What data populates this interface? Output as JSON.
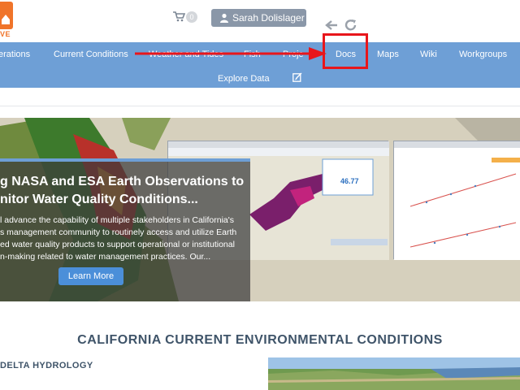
{
  "header": {
    "logo_text": "VE",
    "cart_count": "0",
    "user_name": "Sarah Dolislager",
    "icons": [
      "cart-icon",
      "user-icon",
      "undo-icon",
      "redo-icon"
    ]
  },
  "nav": {
    "row1": [
      "erations",
      "Current Conditions",
      "Weather and Tides",
      "Fish",
      "Proje",
      "Docs",
      "Maps",
      "Wiki",
      "Workgroups"
    ],
    "row2": [
      "Explore Data"
    ],
    "edit_icon": "edit-icon",
    "background": "#6e9fd6"
  },
  "annotation": {
    "target": "Docs",
    "box_color": "#e8161b",
    "arrow_color": "#e8161b"
  },
  "hero": {
    "title": "g NASA and ESA Earth Observations to\nnitor Water Quality Conditions...",
    "title_line1": "g NASA and ESA Earth Observations to",
    "title_line2": "nitor Water Quality Conditions...",
    "body_line1": "l advance the capability of multiple stakeholders in California's",
    "body_line2": "s management community to routinely access and utilize Earth",
    "body_line3": "ed water quality products to support operational or institutional",
    "body_line4": "n-making related to water management practices. Our...",
    "button": "Learn More",
    "inset_value": "46.77"
  },
  "section": {
    "title": "CALIFORNIA CURRENT ENVIRONMENTAL CONDITIONS",
    "subtitle": "DELTA HYDROLOGY"
  }
}
